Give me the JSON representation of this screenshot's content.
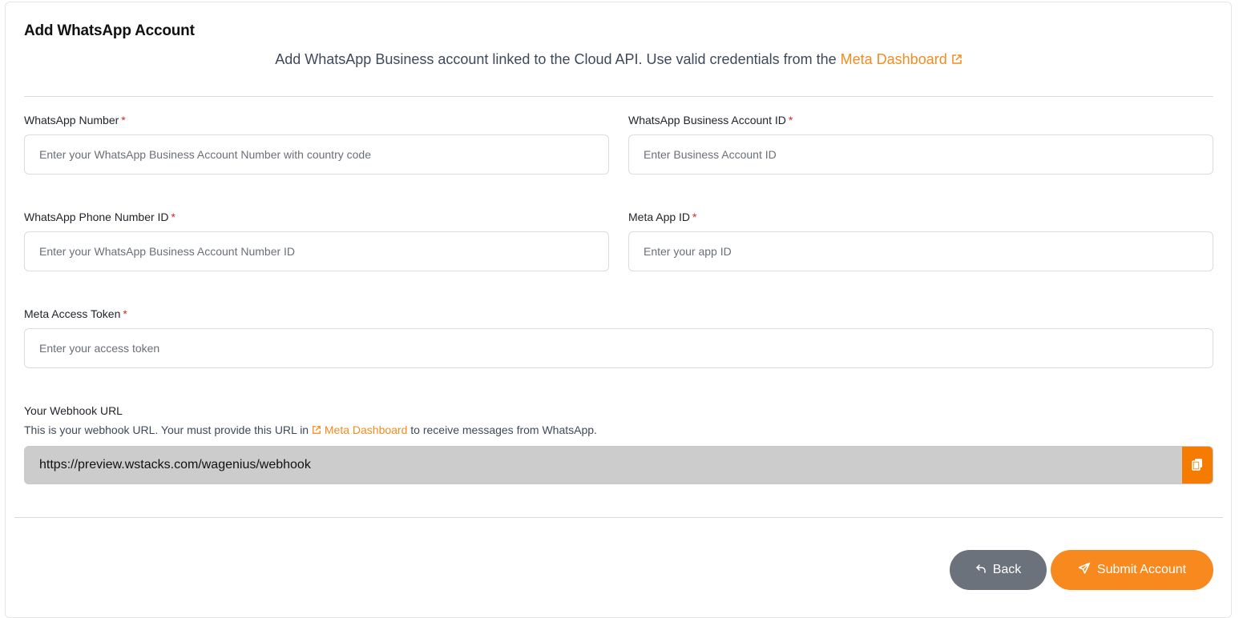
{
  "header": {
    "title": "Add WhatsApp Account",
    "subtitle_text": "Add WhatsApp Business account linked to the Cloud API. Use valid credentials from the",
    "subtitle_link": "Meta Dashboard"
  },
  "form": {
    "whatsapp_number": {
      "label": "WhatsApp Number",
      "required_mark": "*",
      "placeholder": "Enter your WhatsApp Business Account Number with country code",
      "value": ""
    },
    "business_account_id": {
      "label": "WhatsApp Business Account ID",
      "required_mark": "*",
      "placeholder": "Enter Business Account ID",
      "value": ""
    },
    "phone_number_id": {
      "label": "WhatsApp Phone Number ID",
      "required_mark": "*",
      "placeholder": "Enter your WhatsApp Business Account Number ID",
      "value": ""
    },
    "meta_app_id": {
      "label": "Meta App ID",
      "required_mark": "*",
      "placeholder": "Enter your app ID",
      "value": ""
    },
    "access_token": {
      "label": "Meta Access Token",
      "required_mark": "*",
      "placeholder": "Enter your access token",
      "value": ""
    }
  },
  "webhook": {
    "title": "Your Webhook URL",
    "desc_before": "This is your webhook URL. Your must provide this URL in",
    "desc_link": "Meta Dashboard",
    "desc_after": "to receive messages from WhatsApp.",
    "url": "https://preview.wstacks.com/wagenius/webhook",
    "copy_icon": "copy-icon"
  },
  "actions": {
    "back_label": "Back",
    "back_icon": "undo-arrow-icon",
    "submit_label": "Submit Account",
    "submit_icon": "send-paper-plane-icon"
  },
  "colors": {
    "accent": "#f7891f",
    "link": "#f58a1f",
    "back_button": "#6c727b",
    "required": "#e02424",
    "webhook_bg": "#cccccc"
  }
}
